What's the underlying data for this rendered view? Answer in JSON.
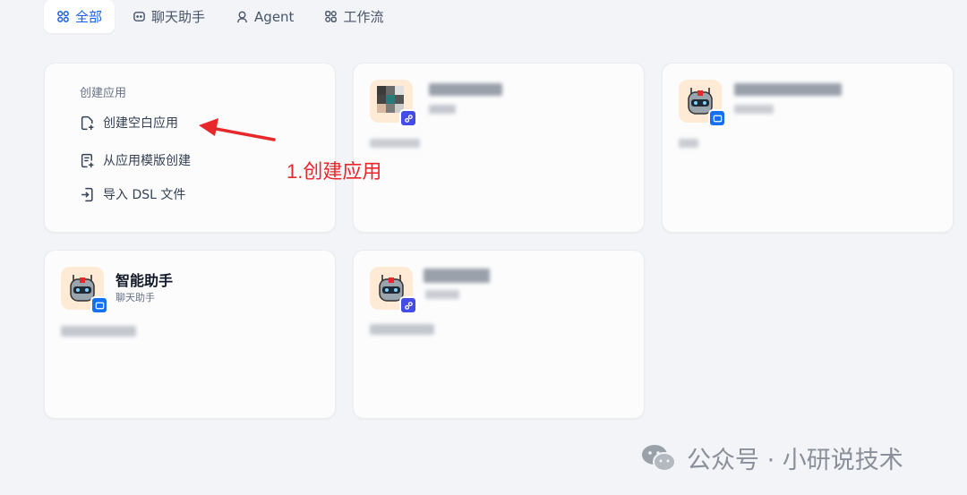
{
  "tabs": [
    {
      "label": "全部",
      "icon": "grid-icon",
      "active": true
    },
    {
      "label": "聊天助手",
      "icon": "chat-icon",
      "active": false
    },
    {
      "label": "Agent",
      "icon": "agent-icon",
      "active": false
    },
    {
      "label": "工作流",
      "icon": "workflow-icon",
      "active": false
    }
  ],
  "create_card": {
    "title": "创建应用",
    "items": [
      {
        "label": "创建空白应用",
        "icon": "new-file-icon"
      },
      {
        "label": "从应用模版创建",
        "icon": "template-icon"
      },
      {
        "label": "导入 DSL 文件",
        "icon": "import-icon"
      }
    ]
  },
  "apps": [
    {
      "name": "智能助手",
      "type": "聊天助手",
      "badge": "chat"
    }
  ],
  "annotation": {
    "text": "1.创建应用",
    "color": "#e8272b"
  },
  "watermark": {
    "text": "公众号 · 小研说技术",
    "icon": "wechat-icon"
  },
  "colors": {
    "accent": "#155eef",
    "icon_bg": "#ffead5",
    "chat_badge": "#1570ef",
    "flow_badge": "#444ce7"
  }
}
